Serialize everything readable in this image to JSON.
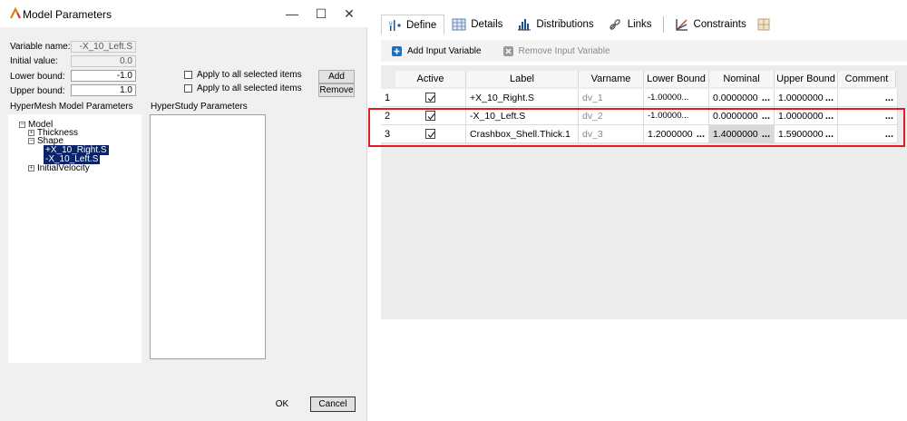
{
  "dialog": {
    "title": "Model Parameters",
    "controls": {
      "minimize": "—",
      "maximize": "☐",
      "close": "✕"
    },
    "variable_name": {
      "label": "Variable name:",
      "value": "-X_10_Left.S"
    },
    "initial_value": {
      "label": "Initial value:",
      "value": "0.0"
    },
    "lower_bound": {
      "label": "Lower bound:",
      "value": "-1.0"
    },
    "upper_bound": {
      "label": "Upper bound:",
      "value": "1.0"
    },
    "apply_all_label": "Apply to all selected items",
    "add_button": "Add",
    "remove_button": "Remove",
    "hypermesh_header": "HyperMesh Model Parameters",
    "hyperstudy_header": "HyperStudy Parameters",
    "tree": {
      "model": "Model",
      "thickness": "Thickness",
      "shape": "Shape",
      "shape_children": [
        "+X_10_Right.S",
        "-X_10_Left.S"
      ],
      "initial_velocity": "InitialVelocity"
    },
    "ok_button": "OK",
    "cancel_button": "Cancel"
  },
  "tabs": [
    {
      "label": "Define",
      "icon": "define-icon"
    },
    {
      "label": "Details",
      "icon": "details-icon"
    },
    {
      "label": "Distributions",
      "icon": "distributions-icon"
    },
    {
      "label": "Links",
      "icon": "links-icon"
    },
    {
      "label": "Constraints",
      "icon": "constraints-icon"
    }
  ],
  "toolbar": {
    "add_label": "Add Input Variable",
    "remove_label": "Remove Input Variable"
  },
  "grid": {
    "headers": [
      "Active",
      "Label",
      "Varname",
      "Lower Bound",
      "Nominal",
      "Upper Bound",
      "Comment"
    ],
    "rows": [
      {
        "num": "1",
        "active": true,
        "label": "+X_10_Right.S",
        "varname": "dv_1",
        "lower": "-1.00000...",
        "nominal": "0.0000000",
        "upper": "1.0000000"
      },
      {
        "num": "2",
        "active": true,
        "label": "-X_10_Left.S",
        "varname": "dv_2",
        "lower": "-1.00000...",
        "nominal": "0.0000000",
        "upper": "1.0000000"
      },
      {
        "num": "3",
        "active": true,
        "label": "Crashbox_Shell.Thick.1",
        "varname": "dv_3",
        "lower": "1.2000000",
        "nominal": "1.4000000",
        "upper": "1.5900000"
      }
    ],
    "ellipsis": "..."
  },
  "colors": {
    "highlight": "#e01b24",
    "selection": "#0a246a",
    "add_icon": "#1f6fbf"
  }
}
